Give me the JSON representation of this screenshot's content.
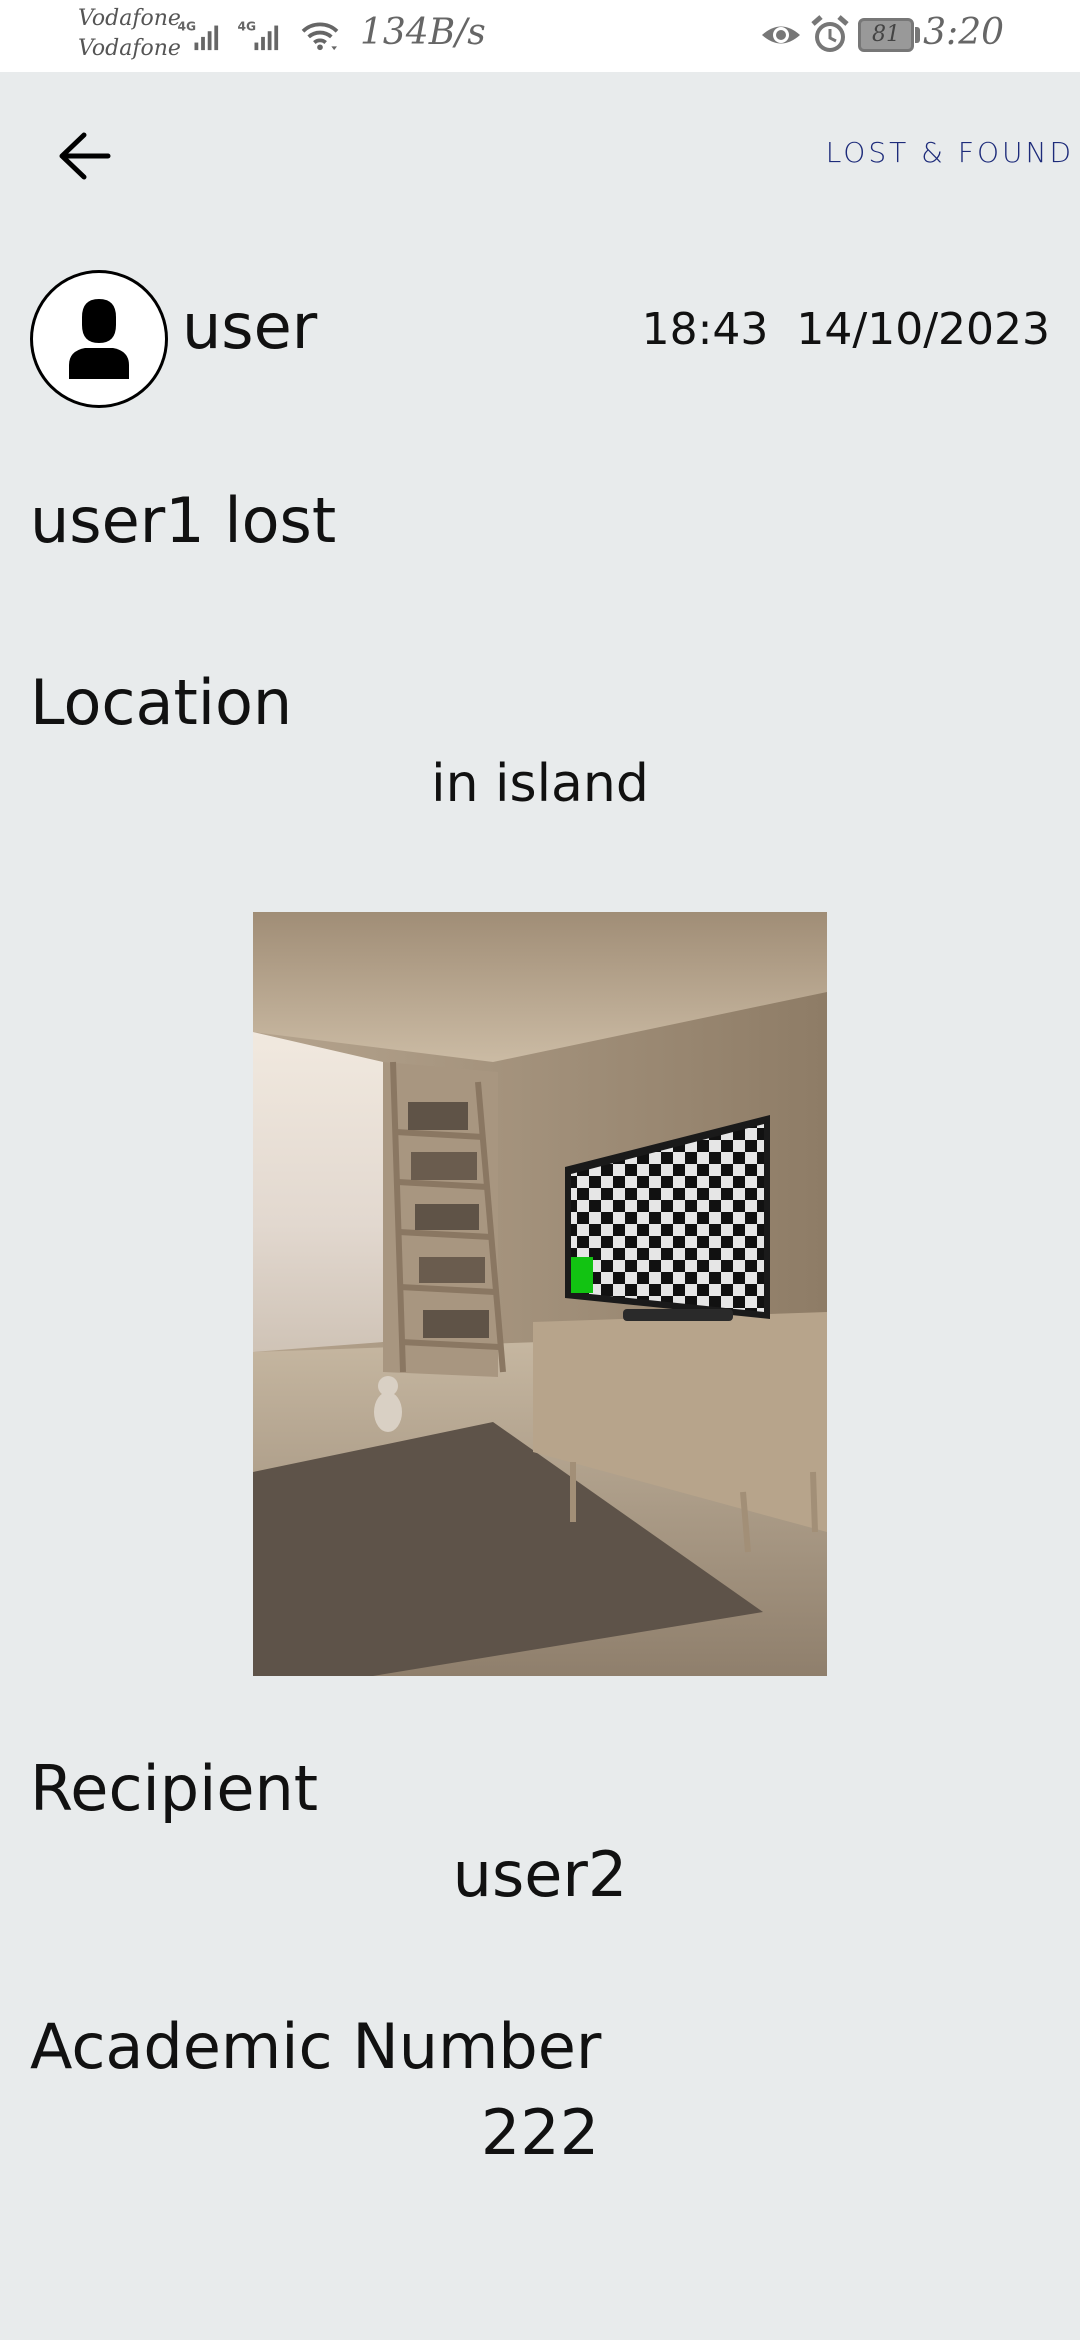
{
  "status_bar": {
    "carrier_1": "Vodafone",
    "carrier_2": "Vodafone",
    "network_1": "4G",
    "network_2": "4G",
    "speed": "134B/s",
    "battery": "81",
    "time": "3:20"
  },
  "header": {
    "back_icon": "arrow-left-icon",
    "title": "LOST & FOUND",
    "title_color": "#1d2b7a"
  },
  "post": {
    "author": "user",
    "avatar_icon": "user-silhouette-icon",
    "time": "18:43",
    "date": "14/10/2023",
    "title": "user1 lost",
    "location_label": "Location",
    "location_value": "in island",
    "recipient_label": "Recipient",
    "recipient_value": "user2",
    "academic_label": "Academic Number",
    "academic_value": "222"
  },
  "colors": {
    "background": "#e8ebec",
    "status_bar": "#ffffff"
  }
}
